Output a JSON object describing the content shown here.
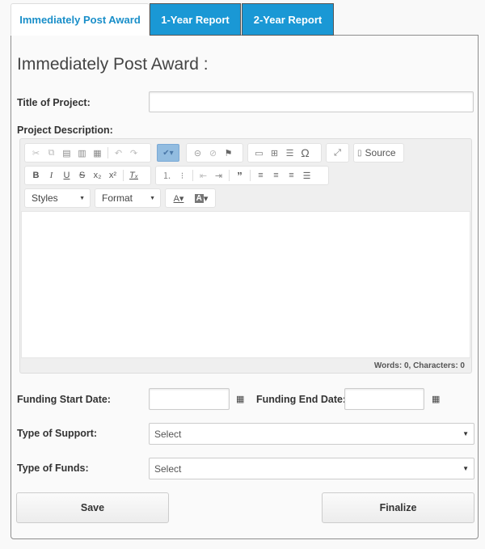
{
  "tabs": [
    {
      "label": "Immediately Post Award",
      "active": true
    },
    {
      "label": "1-Year Report",
      "active": false
    },
    {
      "label": "2-Year Report",
      "active": false
    }
  ],
  "form": {
    "heading": "Immediately Post Award :",
    "title_label": "Title of Project:",
    "title_value": "",
    "description_label": "Project Description:",
    "funding_start_label": "Funding Start Date:",
    "funding_start_value": "",
    "funding_end_label": "Funding End Date:",
    "funding_end_value": "",
    "support_label": "Type of Support:",
    "support_value": "Select",
    "funds_label": "Type of Funds:",
    "funds_value": "Select"
  },
  "editor": {
    "toolbar_row1": [
      "cut-icon",
      "copy-icon",
      "paste-icon",
      "paste-text-icon",
      "paste-word-icon",
      "undo-icon",
      "redo-icon",
      "spellcheck-icon",
      "link-icon",
      "unlink-icon",
      "anchor-icon",
      "image-icon",
      "table-icon",
      "horizontal-line-icon",
      "special-char-icon",
      "maximize-icon",
      "source-icon"
    ],
    "toolbar_row2": [
      "bold-icon",
      "italic-icon",
      "underline-icon",
      "strikethrough-icon",
      "subscript-icon",
      "superscript-icon",
      "remove-format-icon",
      "numbered-list-icon",
      "bulleted-list-icon",
      "outdent-icon",
      "indent-icon",
      "blockquote-icon",
      "align-left-icon",
      "align-center-icon",
      "align-right-icon",
      "justify-icon"
    ],
    "source_label": "Source",
    "styles_label": "Styles",
    "format_label": "Format",
    "content": "",
    "word_count": "Words: 0, Characters: 0"
  },
  "buttons": {
    "save": "Save",
    "finalize": "Finalize"
  }
}
